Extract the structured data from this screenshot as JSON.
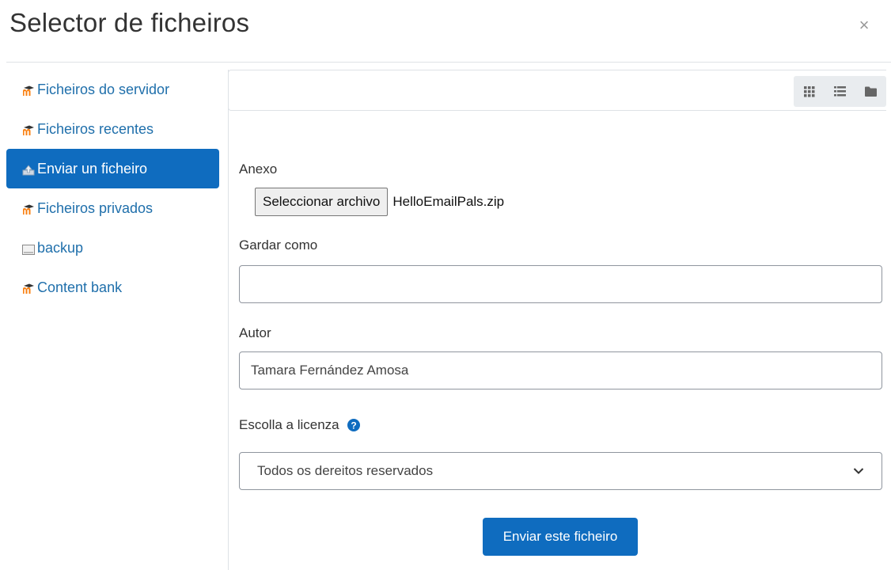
{
  "dialog": {
    "title": "Selector de ficheiros",
    "close_glyph": "×"
  },
  "sidebar": {
    "items": [
      {
        "label": "Ficheiros do servidor",
        "icon": "moodle-icon"
      },
      {
        "label": "Ficheiros recentes",
        "icon": "moodle-icon"
      },
      {
        "label": "Enviar un ficheiro",
        "icon": "upload-icon",
        "active": true
      },
      {
        "label": "Ficheiros privados",
        "icon": "moodle-icon"
      },
      {
        "label": "backup",
        "icon": "folder-icon"
      },
      {
        "label": "Content bank",
        "icon": "moodle-icon"
      }
    ]
  },
  "toolbar": {
    "views": [
      "icons-view-icon",
      "list-view-icon",
      "tree-view-icon"
    ]
  },
  "form": {
    "attachment_label": "Anexo",
    "choose_file_button": "Seleccionar archivo",
    "chosen_file": "HelloEmailPals.zip",
    "save_as_label": "Gardar como",
    "save_as_value": "",
    "author_label": "Autor",
    "author_value": "Tamara Fernández Amosa",
    "license_label": "Escolla a licenza",
    "license_value": "Todos os dereitos reservados",
    "submit_label": "Enviar este ficheiro"
  },
  "colors": {
    "primary": "#0f6cbf",
    "link": "#1f6fab",
    "moodle_orange": "#f98012"
  }
}
